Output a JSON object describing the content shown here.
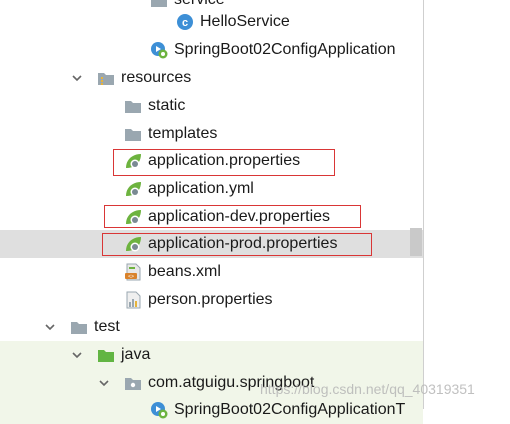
{
  "tree": {
    "items": [
      {
        "label": "service",
        "icon": "folder-icon"
      },
      {
        "label": "HelloService",
        "icon": "class-icon"
      },
      {
        "label": "SpringBoot02ConfigApplication",
        "icon": "spring-boot-app-icon"
      },
      {
        "label": "resources",
        "icon": "resources-folder-icon"
      },
      {
        "label": "static",
        "icon": "folder-icon"
      },
      {
        "label": "templates",
        "icon": "folder-icon"
      },
      {
        "label": "application.properties",
        "icon": "spring-properties-icon"
      },
      {
        "label": "application.yml",
        "icon": "spring-properties-icon"
      },
      {
        "label": "application-dev.properties",
        "icon": "spring-properties-icon"
      },
      {
        "label": "application-prod.properties",
        "icon": "spring-properties-icon"
      },
      {
        "label": "beans.xml",
        "icon": "xml-file-icon"
      },
      {
        "label": "person.properties",
        "icon": "properties-file-icon"
      },
      {
        "label": "test",
        "icon": "folder-icon"
      },
      {
        "label": "java",
        "icon": "test-source-folder-icon"
      },
      {
        "label": "com.atguigu.springboot",
        "icon": "package-icon"
      },
      {
        "label": "SpringBoot02ConfigApplicationT",
        "icon": "spring-boot-app-icon"
      }
    ]
  },
  "colors": {
    "selected_row": "#dfdfdf",
    "highlight_border": "#d93636",
    "spring_green": "#6db33f",
    "class_blue": "#3d8fd6"
  },
  "watermark": "https://blog.csdn.net/qq_40319351"
}
